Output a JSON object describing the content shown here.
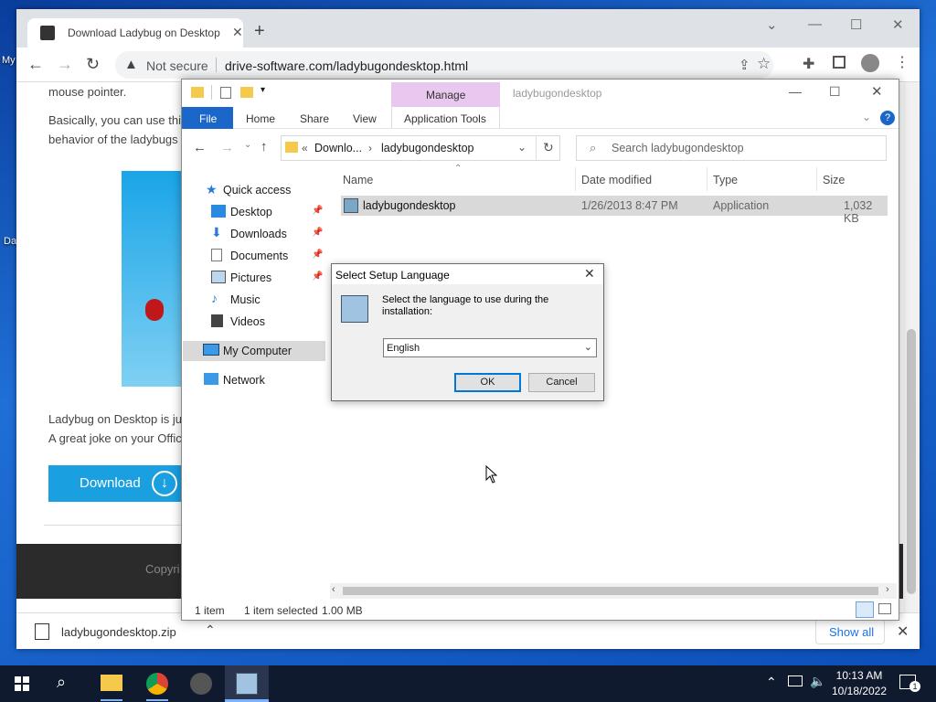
{
  "desktop": {
    "icons": [
      {
        "label": "My"
      },
      {
        "label": "Da"
      }
    ]
  },
  "browser": {
    "tab_title": "Download Ladybug on Desktop |",
    "security_label": "Not secure",
    "url": "drive-software.com/ladybugondesktop.html",
    "page": {
      "line_top": "mouse pointer.",
      "para1_line1": "Basically, you can use this",
      "para1_line2": "behavior of the ladybugs",
      "para2_line1": "Ladybug on Desktop is jus",
      "para2_line2": "A great joke on your Offic",
      "download_label": "Download",
      "footer_text": "Copyri"
    },
    "download_bar": {
      "filename": "ladybugondesktop.zip",
      "show_all": "Show all"
    }
  },
  "explorer": {
    "title": "ladybugondesktop",
    "manage_label": "Manage",
    "ribbon_tabs": [
      "File",
      "Home",
      "Share",
      "View",
      "Application Tools"
    ],
    "address": {
      "crumb_parent": "Downlo...",
      "crumb_current": "ladybugondesktop"
    },
    "search_placeholder": "Search ladybugondesktop",
    "nav": {
      "quick_access": "Quick access",
      "desktop": "Desktop",
      "downloads": "Downloads",
      "documents": "Documents",
      "pictures": "Pictures",
      "music": "Music",
      "videos": "Videos",
      "my_computer": "My Computer",
      "network": "Network"
    },
    "columns": {
      "name": "Name",
      "date": "Date modified",
      "type": "Type",
      "size": "Size"
    },
    "files": [
      {
        "name": "ladybugondesktop",
        "date": "1/26/2013 8:47 PM",
        "type": "Application",
        "size": "1,032 KB"
      }
    ],
    "status": {
      "count": "1 item",
      "selected": "1 item selected",
      "size": "1.00 MB"
    }
  },
  "dialog": {
    "title": "Select Setup Language",
    "prompt": "Select the language to use during the installation:",
    "language": "English",
    "ok": "OK",
    "cancel": "Cancel"
  },
  "taskbar": {
    "time": "10:13 AM",
    "date": "10/18/2022",
    "notification_count": "1"
  },
  "colors": {
    "accent": "#0078d7",
    "file_tab": "#1a66c9",
    "manage_tab": "#e8c8ef",
    "download_button": "#1a9fe0",
    "taskbar": "#101a2e"
  }
}
